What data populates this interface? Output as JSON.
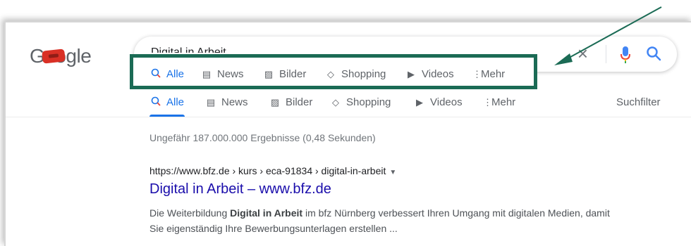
{
  "logo": {
    "text": "Google"
  },
  "search": {
    "value": "Digital in Arbeit"
  },
  "tabs": [
    {
      "label": "Alle",
      "icon": "search-icon",
      "active": true
    },
    {
      "label": "News",
      "icon": "news-icon"
    },
    {
      "label": "Bilder",
      "icon": "image-icon"
    },
    {
      "label": "Shopping",
      "icon": "tag-icon"
    },
    {
      "label": "Videos",
      "icon": "play-icon"
    },
    {
      "label": "Mehr",
      "icon": "more-vert-icon"
    }
  ],
  "suchfilter": "Suchfilter",
  "stats": "Ungefähr 187.000.000 Ergebnisse (0,48 Sekunden)",
  "result": {
    "url": "https://www.bfz.de › kurs › eca-91834 › digital-in-arbeit",
    "title": "Digital in Arbeit – www.bfz.de",
    "snippet_pre": "Die Weiterbildung ",
    "snippet_bold": "Digital in Arbeit",
    "snippet_post": " im bfz Nürnberg verbessert Ihren Umgang mit digitalen Medien, damit Sie eigenständig Ihre Bewerbungsunterlagen erstellen ..."
  },
  "colors": {
    "accent": "#1a73e8",
    "link": "#1a0dab",
    "highlight_border": "#1b6b55"
  }
}
